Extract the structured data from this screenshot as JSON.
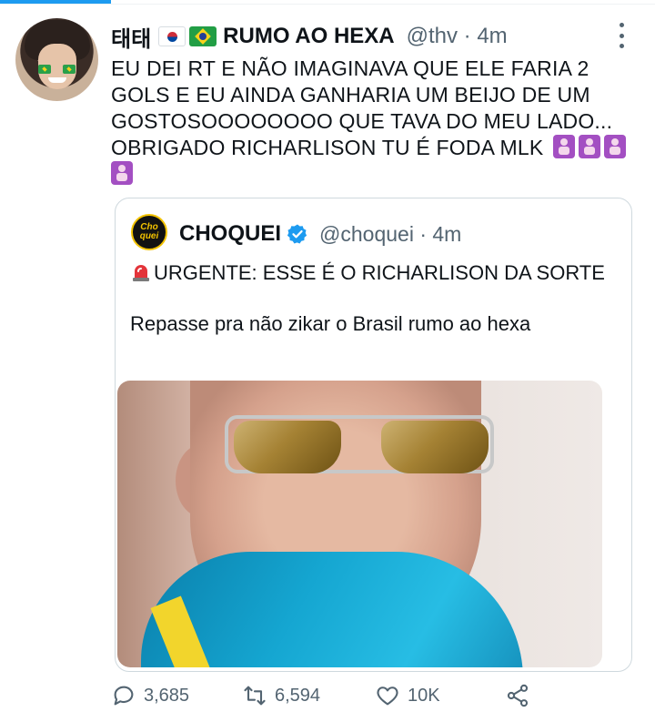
{
  "colors": {
    "accent": "#1d9bf0",
    "text": "#0f1419",
    "secondary": "#536471",
    "border": "#cfd9de",
    "verified": "#1d9bf0"
  },
  "tweet": {
    "display_name": "태태",
    "flags": [
      "south-korea-flag-icon",
      "brazil-flag-icon"
    ],
    "display_name_suffix": "RUMO AO HEXA",
    "handle_time": "@thv · 4m",
    "text": "EU DEI RT E NÃO IMAGINAVA QUE ELE FARIA 2 GOLS E EU AINDA GANHARIA UM BEIJO DE UM GOSTOSOOOOOOOO QUE TAVA DO MEU LADO... OBRIGADO RICHARLISON TU É FODA MLK",
    "trailing_emoji": [
      "praying-emoji",
      "praying-emoji",
      "praying-emoji",
      "praying-emoji"
    ]
  },
  "quote": {
    "avatar_text": "Cho quei",
    "display_name": "CHOQUEI",
    "handle_time": "@choquei · 4m",
    "line1": "URGENTE: ESSE É O RICHARLISON DA SORTE",
    "line2": "Repasse pra não zikar o Brasil rumo ao hexa",
    "image": "photo-man-gold-sunglasses-blue-jacket"
  },
  "actions": {
    "reply_count": "3,685",
    "retweet_count": "6,594",
    "like_count": "10K",
    "share_icon": "share-icon"
  }
}
